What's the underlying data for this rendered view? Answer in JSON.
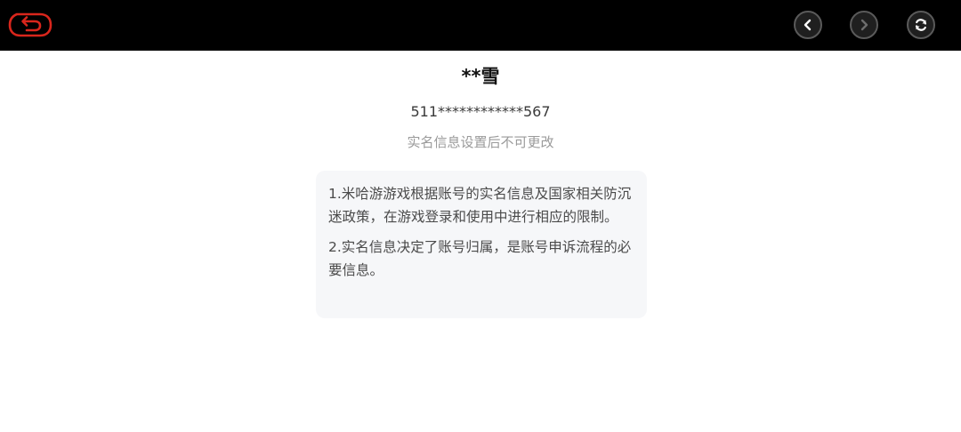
{
  "toolbar": {
    "back_icon": "back-arrow-icon",
    "prev_icon": "chevron-left-icon",
    "next_icon": "chevron-right-icon",
    "refresh_icon": "refresh-icon",
    "accent_color": "#d9261c"
  },
  "profile": {
    "name": "**雪",
    "id_number": "511************567",
    "hint": "实名信息设置后不可更改"
  },
  "notice": {
    "items": [
      "1.米哈游游戏根据账号的实名信息及国家相关防沉迷政策，在游戏登录和使用中进行相应的限制。",
      "2.实名信息决定了账号归属，是账号申诉流程的必要信息。"
    ]
  }
}
